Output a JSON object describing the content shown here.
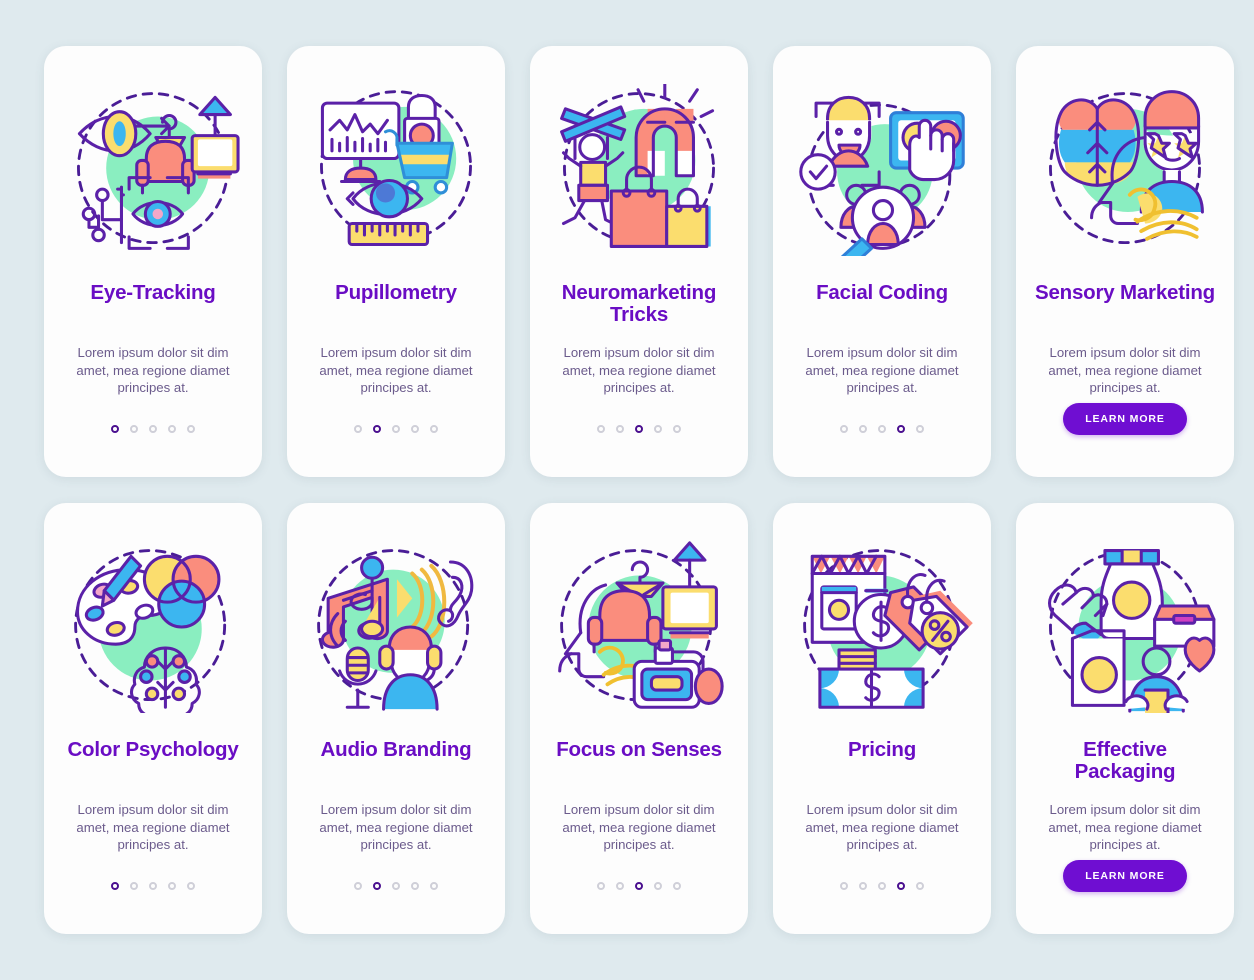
{
  "theme": {
    "background": "#dfeaee",
    "card_background": "#fdfdfd",
    "title_color": "#6a0dc4",
    "body_color": "#6b5b8c",
    "accent_color": "#6f0ed2",
    "dot_active": "#4a0f8f",
    "dot_inactive": "#cfcfd8",
    "illustration_outline": "#5b21a8",
    "illustration_mint": "#8aeec0",
    "illustration_pink": "#fa8d7d",
    "illustration_yellow": "#fbdd6e",
    "illustration_blue": "#3cb6f0"
  },
  "shared": {
    "body_text": "Lorem ipsum dolor sit dim amet, mea regione diamet principes at.",
    "cta_label": "LEARN MORE",
    "dot_count": 5
  },
  "rows": [
    {
      "cards": [
        {
          "title": "Eye-Tracking",
          "icon": "eye-tracking-icon",
          "active_dot": 0,
          "has_cta": false
        },
        {
          "title": "Pupillometry",
          "icon": "pupillometry-icon",
          "active_dot": 1,
          "has_cta": false
        },
        {
          "title": "Neuromarketing Tricks",
          "icon": "neuromarketing-tricks-icon",
          "active_dot": 2,
          "has_cta": false
        },
        {
          "title": "Facial Coding",
          "icon": "facial-coding-icon",
          "active_dot": 3,
          "has_cta": false
        },
        {
          "title": "Sensory Marketing",
          "icon": "sensory-marketing-icon",
          "active_dot": 4,
          "has_cta": true
        }
      ]
    },
    {
      "cards": [
        {
          "title": "Color Psychology",
          "icon": "color-psychology-icon",
          "active_dot": 0,
          "has_cta": false
        },
        {
          "title": "Audio Branding",
          "icon": "audio-branding-icon",
          "active_dot": 1,
          "has_cta": false
        },
        {
          "title": "Focus on Senses",
          "icon": "focus-on-senses-icon",
          "active_dot": 2,
          "has_cta": false
        },
        {
          "title": "Pricing",
          "icon": "pricing-icon",
          "active_dot": 3,
          "has_cta": false
        },
        {
          "title": "Effective Packaging",
          "icon": "effective-packaging-icon",
          "active_dot": 4,
          "has_cta": true
        }
      ]
    }
  ]
}
